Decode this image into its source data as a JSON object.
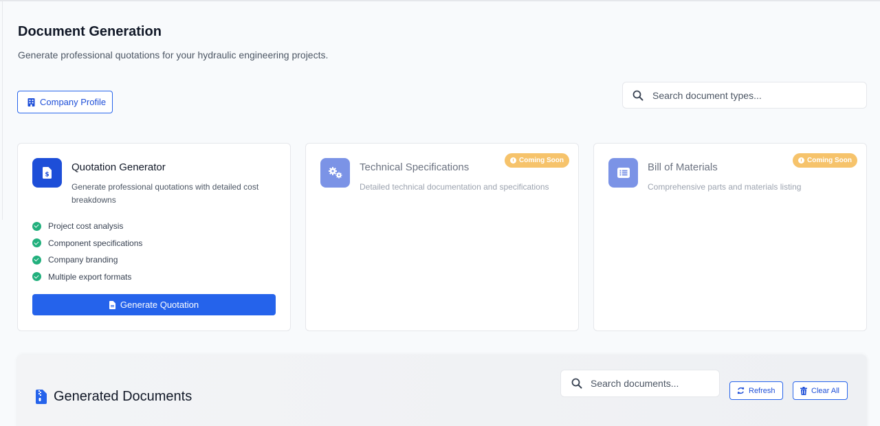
{
  "page": {
    "title": "Document Generation",
    "subtitle": "Generate professional quotations for your hydraulic engineering projects."
  },
  "toolbar": {
    "company_profile_label": "Company Profile",
    "search_placeholder": "Search document types..."
  },
  "cards": [
    {
      "title": "Quotation Generator",
      "description": "Generate professional quotations with detailed cost breakdowns",
      "icon": "file-invoice-dollar-icon",
      "features": [
        "Project cost analysis",
        "Component specifications",
        "Company branding",
        "Multiple export formats"
      ],
      "action_label": "Generate Quotation"
    },
    {
      "title": "Technical Specifications",
      "description": "Detailed technical documentation and specifications",
      "icon": "cogs-icon",
      "badge": "Coming Soon"
    },
    {
      "title": "Bill of Materials",
      "description": "Comprehensive parts and materials listing",
      "icon": "list-icon",
      "badge": "Coming Soon"
    }
  ],
  "generated_documents": {
    "title": "Generated Documents",
    "search_placeholder": "Search documents...",
    "refresh_label": "Refresh",
    "clear_all_label": "Clear All"
  },
  "colors": {
    "primary": "#2563eb",
    "badge": "#f6c36b",
    "check": "#22b07d"
  }
}
